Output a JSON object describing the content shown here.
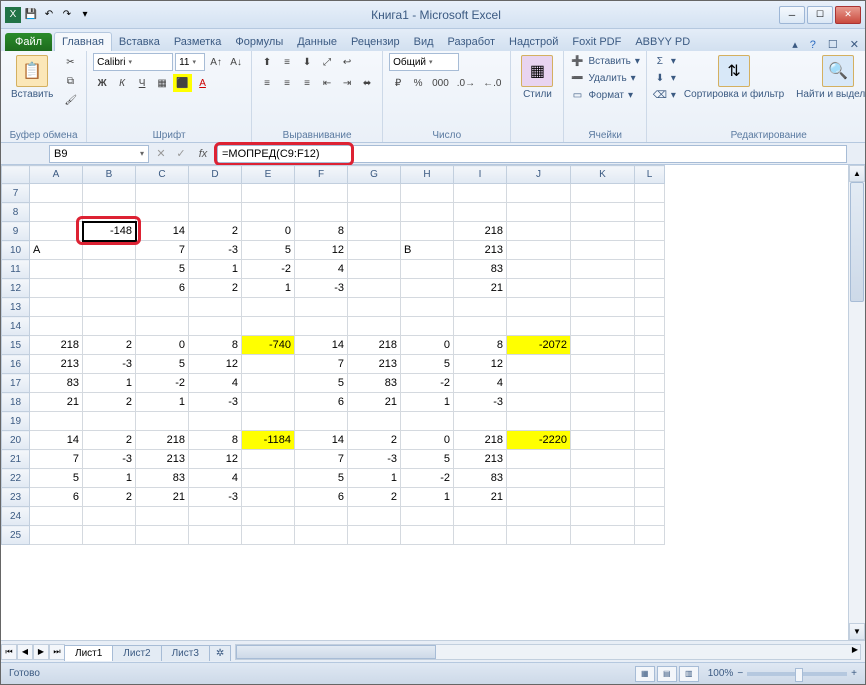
{
  "window": {
    "title": "Книга1 - Microsoft Excel"
  },
  "tabs": {
    "file": "Файл",
    "items": [
      "Главная",
      "Вставка",
      "Разметка",
      "Формулы",
      "Данные",
      "Рецензир",
      "Вид",
      "Разработ",
      "Надстрой",
      "Foxit PDF",
      "ABBYY PD"
    ],
    "active": 0
  },
  "ribbon": {
    "clipboard": {
      "label": "Буфер обмена",
      "paste": "Вставить"
    },
    "font": {
      "label": "Шрифт",
      "name": "Calibri",
      "size": "11"
    },
    "align": {
      "label": "Выравнивание"
    },
    "number": {
      "label": "Число",
      "format": "Общий"
    },
    "styles": {
      "label": "Стили",
      "btn": "Стили"
    },
    "cells": {
      "label": "Ячейки",
      "insert": "Вставить",
      "delete": "Удалить",
      "format": "Формат"
    },
    "editing": {
      "label": "Редактирование",
      "sort": "Сортировка и фильтр",
      "find": "Найти и выделить"
    }
  },
  "namebox": "B9",
  "formula": "=МОПРЕД(C9:F12)",
  "columns": [
    "A",
    "B",
    "C",
    "D",
    "E",
    "F",
    "G",
    "H",
    "I",
    "J",
    "K",
    "L"
  ],
  "rows": [
    7,
    8,
    9,
    10,
    11,
    12,
    13,
    14,
    15,
    16,
    17,
    18,
    19,
    20,
    21,
    22,
    23,
    24,
    25
  ],
  "cells": {
    "B9": {
      "v": "-148",
      "sel": true
    },
    "C9": {
      "v": "14"
    },
    "D9": {
      "v": "2"
    },
    "E9": {
      "v": "0"
    },
    "F9": {
      "v": "8"
    },
    "I9": {
      "v": "218"
    },
    "A10": {
      "v": "A",
      "t": true
    },
    "C10": {
      "v": "7"
    },
    "D10": {
      "v": "-3"
    },
    "E10": {
      "v": "5"
    },
    "F10": {
      "v": "12"
    },
    "H10": {
      "v": "B",
      "t": true
    },
    "I10": {
      "v": "213"
    },
    "C11": {
      "v": "5"
    },
    "D11": {
      "v": "1"
    },
    "E11": {
      "v": "-2"
    },
    "F11": {
      "v": "4"
    },
    "I11": {
      "v": "83"
    },
    "C12": {
      "v": "6"
    },
    "D12": {
      "v": "2"
    },
    "E12": {
      "v": "1"
    },
    "F12": {
      "v": "-3"
    },
    "I12": {
      "v": "21"
    },
    "A15": {
      "v": "218"
    },
    "B15": {
      "v": "2"
    },
    "C15": {
      "v": "0"
    },
    "D15": {
      "v": "8"
    },
    "E15": {
      "v": "-740",
      "y": true
    },
    "F15": {
      "v": "14"
    },
    "G15": {
      "v": "218"
    },
    "H15": {
      "v": "0"
    },
    "I15": {
      "v": "8"
    },
    "J15": {
      "v": "-2072",
      "y": true
    },
    "A16": {
      "v": "213"
    },
    "B16": {
      "v": "-3"
    },
    "C16": {
      "v": "5"
    },
    "D16": {
      "v": "12"
    },
    "F16": {
      "v": "7"
    },
    "G16": {
      "v": "213"
    },
    "H16": {
      "v": "5"
    },
    "I16": {
      "v": "12"
    },
    "A17": {
      "v": "83"
    },
    "B17": {
      "v": "1"
    },
    "C17": {
      "v": "-2"
    },
    "D17": {
      "v": "4"
    },
    "F17": {
      "v": "5"
    },
    "G17": {
      "v": "83"
    },
    "H17": {
      "v": "-2"
    },
    "I17": {
      "v": "4"
    },
    "A18": {
      "v": "21"
    },
    "B18": {
      "v": "2"
    },
    "C18": {
      "v": "1"
    },
    "D18": {
      "v": "-3"
    },
    "F18": {
      "v": "6"
    },
    "G18": {
      "v": "21"
    },
    "H18": {
      "v": "1"
    },
    "I18": {
      "v": "-3"
    },
    "A20": {
      "v": "14"
    },
    "B20": {
      "v": "2"
    },
    "C20": {
      "v": "218"
    },
    "D20": {
      "v": "8"
    },
    "E20": {
      "v": "-1184",
      "y": true
    },
    "F20": {
      "v": "14"
    },
    "G20": {
      "v": "2"
    },
    "H20": {
      "v": "0"
    },
    "I20": {
      "v": "218"
    },
    "J20": {
      "v": "-2220",
      "y": true
    },
    "A21": {
      "v": "7"
    },
    "B21": {
      "v": "-3"
    },
    "C21": {
      "v": "213"
    },
    "D21": {
      "v": "12"
    },
    "F21": {
      "v": "7"
    },
    "G21": {
      "v": "-3"
    },
    "H21": {
      "v": "5"
    },
    "I21": {
      "v": "213"
    },
    "A22": {
      "v": "5"
    },
    "B22": {
      "v": "1"
    },
    "C22": {
      "v": "83"
    },
    "D22": {
      "v": "4"
    },
    "F22": {
      "v": "5"
    },
    "G22": {
      "v": "1"
    },
    "H22": {
      "v": "-2"
    },
    "I22": {
      "v": "83"
    },
    "A23": {
      "v": "6"
    },
    "B23": {
      "v": "2"
    },
    "C23": {
      "v": "21"
    },
    "D23": {
      "v": "-3"
    },
    "F23": {
      "v": "6"
    },
    "G23": {
      "v": "2"
    },
    "H23": {
      "v": "1"
    },
    "I23": {
      "v": "21"
    }
  },
  "sheets": {
    "active": "Лист1",
    "others": [
      "Лист2",
      "Лист3"
    ]
  },
  "status": {
    "ready": "Готово",
    "zoom": "100%"
  }
}
